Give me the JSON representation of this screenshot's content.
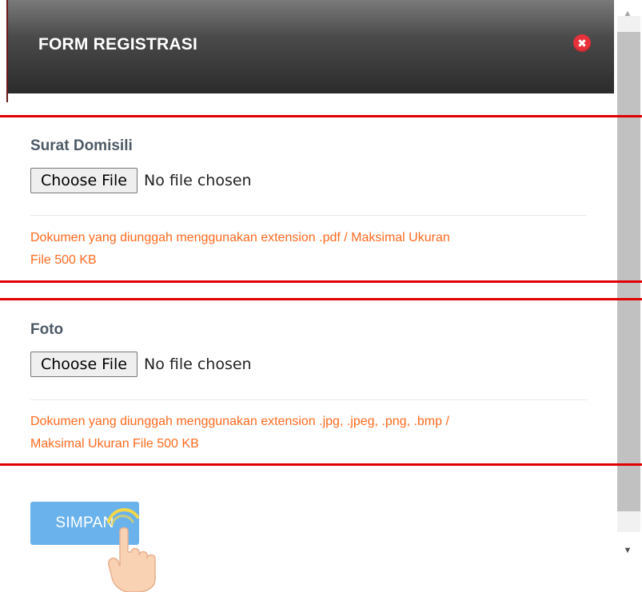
{
  "header": {
    "title": "FORM REGISTRASI",
    "close_icon": "close-icon",
    "close_symbol": "✖"
  },
  "sections": [
    {
      "label": "Surat Domisili",
      "button_label": "Choose File",
      "status": "No file chosen",
      "hint_line1": "Dokumen yang diunggah menggunakan extension .pdf / Maksimal Ukuran",
      "hint_line2": "File 500 KB"
    },
    {
      "label": "Foto",
      "button_label": "Choose File",
      "status": "No file chosen",
      "hint_line1": "Dokumen yang diunggah menggunakan extension .jpg, .jpeg, .png, .bmp /",
      "hint_line2": "Maksimal Ukuran File 500 KB"
    }
  ],
  "submit": {
    "label": "SIMPAN"
  },
  "scrollbar": {
    "up_symbol": "▲",
    "down_symbol": "▼"
  },
  "colors": {
    "highlight": "#e00000",
    "hint_text": "#ff6a1f",
    "button": "#6ab2ec",
    "close": "#e8313b",
    "header_dark": "#2b2b2b"
  }
}
